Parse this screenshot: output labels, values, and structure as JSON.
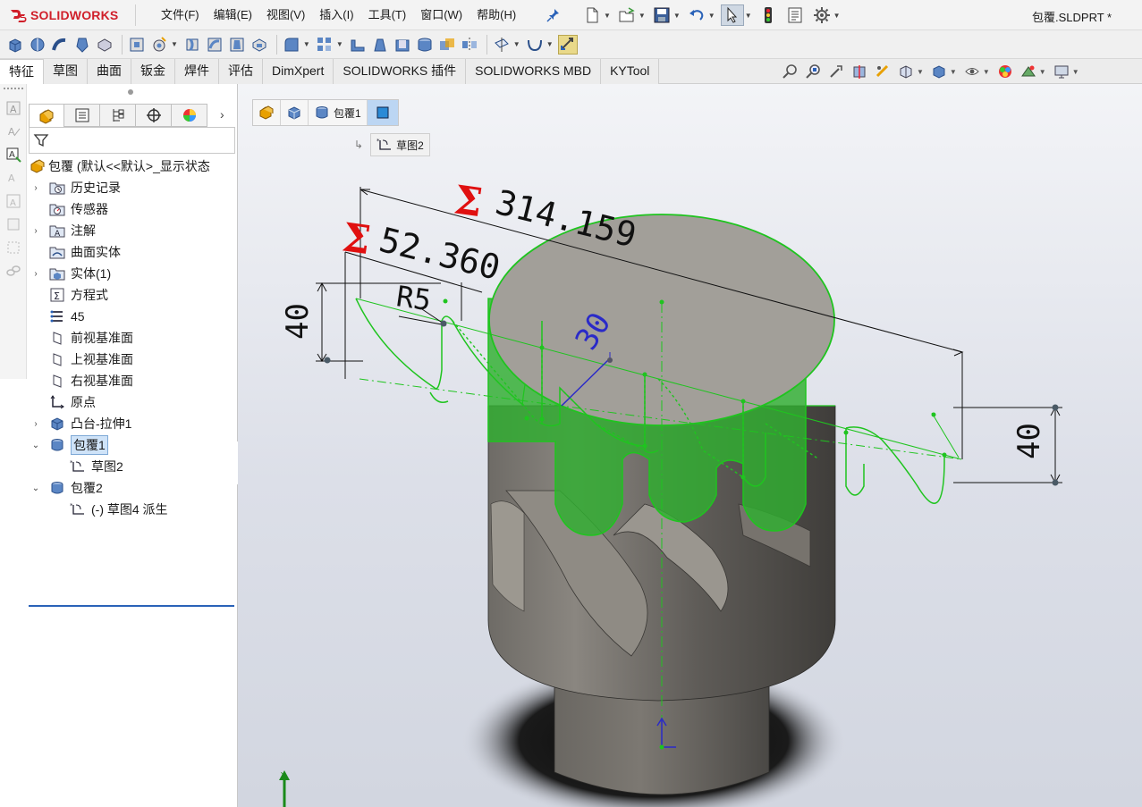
{
  "app": {
    "brand": "SOLIDWORKS",
    "document_title": "包覆.SLDPRT *",
    "accent_red": "#d01f2a",
    "sketch_green": "#1fc41f"
  },
  "menu": [
    "文件(F)",
    "编辑(E)",
    "视图(V)",
    "插入(I)",
    "工具(T)",
    "窗口(W)",
    "帮助(H)"
  ],
  "quick_access": [
    "new-icon",
    "open-icon",
    "save-icon",
    "undo-icon",
    "select-icon",
    "rebuild-icon",
    "file-properties-icon",
    "options-icon"
  ],
  "command_tabs": [
    {
      "label": "特征",
      "active": true
    },
    {
      "label": "草图",
      "active": false
    },
    {
      "label": "曲面",
      "active": false
    },
    {
      "label": "钣金",
      "active": false
    },
    {
      "label": "焊件",
      "active": false
    },
    {
      "label": "评估",
      "active": false
    },
    {
      "label": "DimXpert",
      "active": false
    },
    {
      "label": "SOLIDWORKS 插件",
      "active": false
    },
    {
      "label": "SOLIDWORKS MBD",
      "active": false
    },
    {
      "label": "KYTool",
      "active": false
    }
  ],
  "feature_tree": {
    "root": "包覆  (默认<<默认>_显示状态",
    "items": [
      {
        "label": "历史记录",
        "icon": "history-folder-icon",
        "expandable": true
      },
      {
        "label": "传感器",
        "icon": "sensor-icon",
        "expandable": false
      },
      {
        "label": "注解",
        "icon": "annotation-icon",
        "expandable": true
      },
      {
        "label": "曲面实体",
        "icon": "surface-bodies-icon",
        "expandable": false
      },
      {
        "label": "实体(1)",
        "icon": "solid-bodies-icon",
        "expandable": true
      },
      {
        "label": "方程式",
        "icon": "equations-icon",
        "expandable": false
      },
      {
        "label": "45",
        "icon": "material-icon",
        "expandable": false
      },
      {
        "label": "前视基准面",
        "icon": "plane-icon",
        "expandable": false
      },
      {
        "label": "上视基准面",
        "icon": "plane-icon",
        "expandable": false
      },
      {
        "label": "右视基准面",
        "icon": "plane-icon",
        "expandable": false
      },
      {
        "label": "原点",
        "icon": "origin-icon",
        "expandable": false
      },
      {
        "label": "凸台-拉伸1",
        "icon": "boss-extrude-icon",
        "expandable": true
      },
      {
        "label": "包覆1",
        "icon": "wrap-feature-icon",
        "expandable": true,
        "expanded": true,
        "selected": true
      },
      {
        "label": "草图2",
        "icon": "sketch-icon",
        "child": true
      },
      {
        "label": "包覆2",
        "icon": "wrap-feature-icon",
        "expandable": true,
        "expanded": true
      },
      {
        "label": "(-) 草图4 派生",
        "icon": "sketch-icon",
        "child": true
      }
    ]
  },
  "breadcrumb": {
    "items": [
      "part-icon",
      "body-icon",
      "包覆1",
      "face-icon"
    ],
    "wrap_label": "包覆1",
    "sub_label": "草图2"
  },
  "dimensions": {
    "length_total": "314.159",
    "length_partial": "52.360",
    "radius": "R5",
    "angle": "30",
    "height_left": "40",
    "height_right": "40",
    "sigma": "Σ"
  }
}
